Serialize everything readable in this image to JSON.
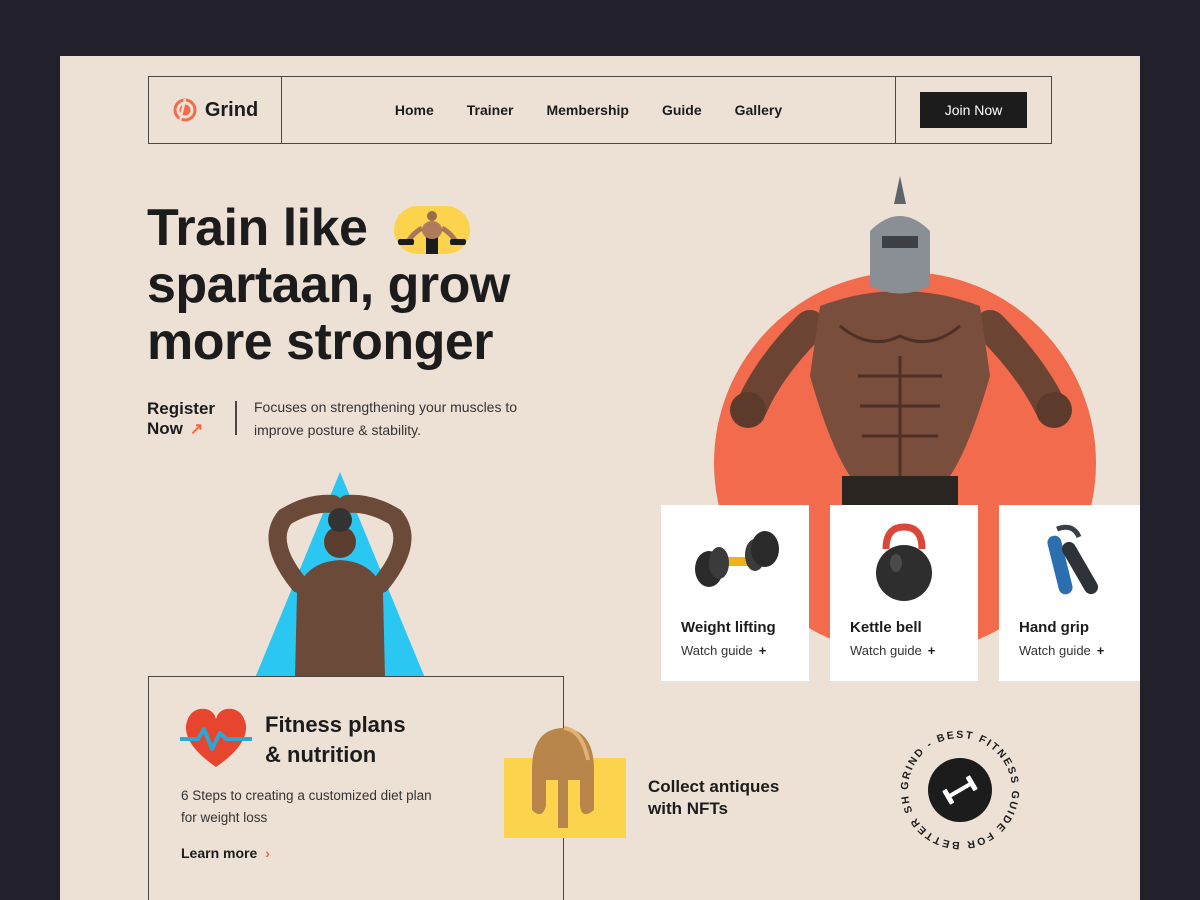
{
  "brand": {
    "name": "Grind",
    "accent": "#f26b4d",
    "dark": "#1c1c1c",
    "background": "#ede1d6",
    "yellow": "#fcd34d",
    "blue": "#2bc7f3"
  },
  "nav": {
    "links": [
      "Home",
      "Trainer",
      "Membership",
      "Guide",
      "Gallery"
    ],
    "cta_label": "Join Now"
  },
  "hero": {
    "title_lines": [
      "Train like",
      "spartaan, grow",
      "more stronger"
    ],
    "register_line1": "Register",
    "register_line2": "Now",
    "register_icon": "arrow-up-right-icon",
    "description": "Focuses on strengthening your muscles to improve posture & stability."
  },
  "equipment": [
    {
      "title": "Weight lifting",
      "link": "Watch guide",
      "icon": "dumbbell-icon"
    },
    {
      "title": "Kettle bell",
      "link": "Watch guide",
      "icon": "kettlebell-icon"
    },
    {
      "title": "Hand grip",
      "link": "Watch guide",
      "icon": "hand-grip-icon"
    }
  ],
  "fitness": {
    "title_line1": "Fitness plans",
    "title_line2": "& nutrition",
    "description": "6 Steps to creating a customized diet plan for weight loss",
    "link": "Learn more",
    "icon": "heart-pulse-icon"
  },
  "nft": {
    "line1": "Collect antiques",
    "line2": "with NFTs",
    "icon": "spartan-helmet-icon"
  },
  "badge": {
    "ring_text": "GRIND - BEST FITNESS GUIDE FOR BETTER SHAPE -",
    "icon": "dumbbell-icon"
  }
}
